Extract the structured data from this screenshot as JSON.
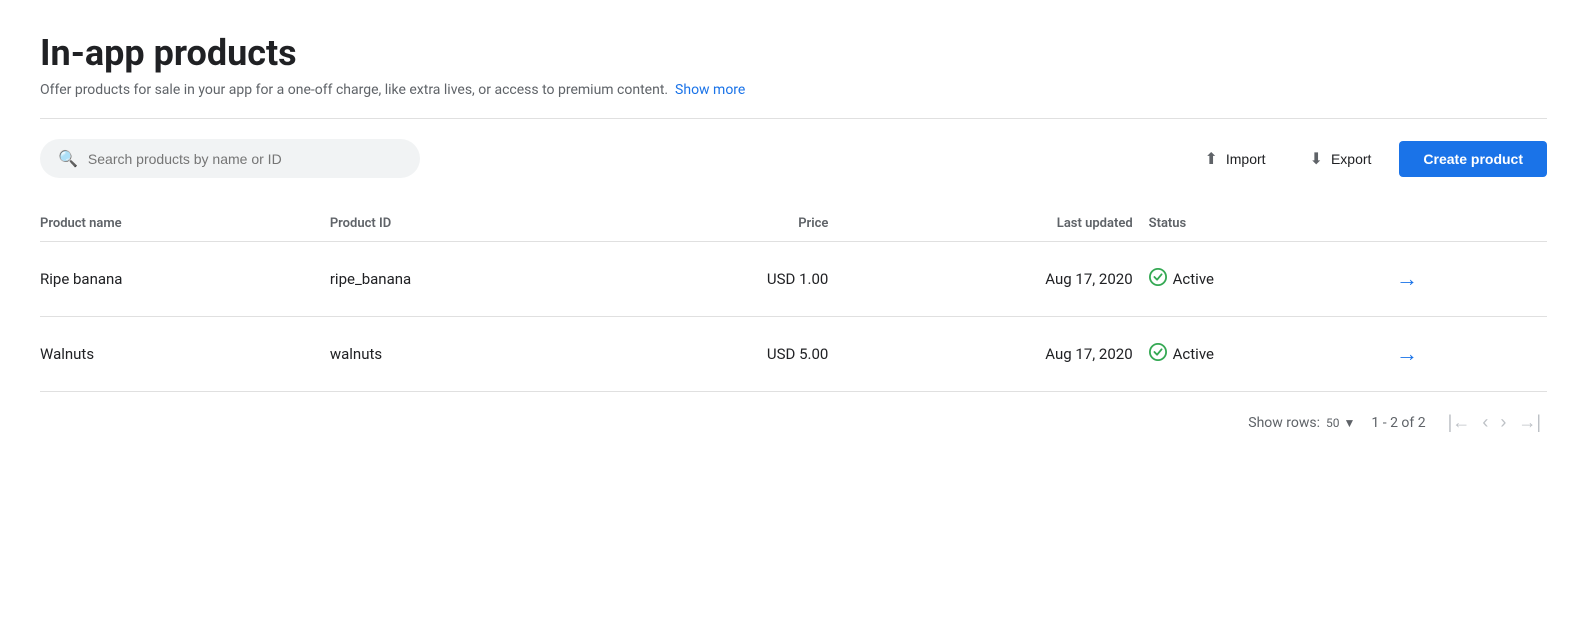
{
  "page": {
    "title": "In-app products",
    "subtitle": "Offer products for sale in your app for a one-off charge, like extra lives, or access to premium content.",
    "show_more_label": "Show more"
  },
  "toolbar": {
    "search_placeholder": "Search products by name or ID",
    "import_label": "Import",
    "export_label": "Export",
    "create_label": "Create product"
  },
  "table": {
    "headers": [
      {
        "key": "name",
        "label": "Product name"
      },
      {
        "key": "id",
        "label": "Product ID"
      },
      {
        "key": "price",
        "label": "Price"
      },
      {
        "key": "updated",
        "label": "Last updated"
      },
      {
        "key": "status",
        "label": "Status"
      }
    ],
    "rows": [
      {
        "name": "Ripe banana",
        "product_id": "ripe_banana",
        "price": "USD 1.00",
        "last_updated": "Aug 17, 2020",
        "status": "Active"
      },
      {
        "name": "Walnuts",
        "product_id": "walnuts",
        "price": "USD 5.00",
        "last_updated": "Aug 17, 2020",
        "status": "Active"
      }
    ]
  },
  "pagination": {
    "show_rows_label": "Show rows:",
    "rows_value": "50",
    "page_info": "1 - 2 of 2"
  }
}
